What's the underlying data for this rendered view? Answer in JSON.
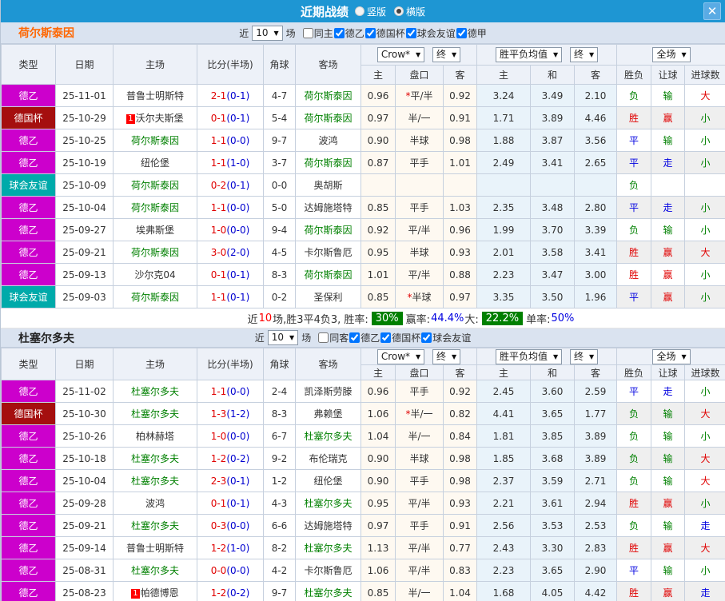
{
  "titlebar": {
    "title": "近期战绩",
    "options": [
      {
        "label": "竖版",
        "selected": false
      },
      {
        "label": "横版",
        "selected": true
      }
    ],
    "close_glyph": "✕"
  },
  "labels": {
    "near": "近",
    "matches": "场"
  },
  "columns": {
    "type": "类型",
    "date": "日期",
    "home": "主场",
    "score": "比分(半场)",
    "corner": "角球",
    "away": "客场",
    "odds_home": "主",
    "handicap": "盘口",
    "odds_away": "客",
    "mean_home": "主",
    "mean_draw": "和",
    "mean_away": "客",
    "result": "胜负",
    "handicap_result": "让球",
    "goals": "进球数"
  },
  "dropdowns": {
    "crow": "Crow*",
    "final1": "终",
    "mean": "胜平负均值",
    "final2": "终",
    "fullmatch": "全场"
  },
  "type_colors": {
    "德乙": "#cc00cc",
    "德国杯": "#a50f0f",
    "球会友谊": "#00aaaa"
  },
  "result_colors": {
    "胜": "#e00000",
    "赢": "#e00000",
    "大": "#e00000",
    "平": "#0000e0",
    "走": "#0000e0",
    "负": "#008000",
    "输": "#008000",
    "小": "#008000"
  },
  "team_green": "#008000",
  "sections": [
    {
      "team": "荷尔斯泰因",
      "team_color": "#ff6600",
      "filter": {
        "count": "10",
        "items": [
          {
            "label": "同主",
            "checked": false
          },
          {
            "label": "德乙",
            "checked": true
          },
          {
            "label": "德国杯",
            "checked": true
          },
          {
            "label": "球会友谊",
            "checked": true
          },
          {
            "label": "德甲",
            "checked": true
          }
        ]
      },
      "rows": [
        {
          "type": "德乙",
          "date": "25-11-01",
          "home": "普鲁士明斯特",
          "badge": "",
          "score": "2-1",
          "half": "(0-1)",
          "corner": "4-7",
          "away": "荷尔斯泰因",
          "odds_home": "0.96",
          "star": true,
          "handicap": "平/半",
          "odds_away": "0.92",
          "mean_home": "3.24",
          "mean_draw": "3.49",
          "mean_away": "2.10",
          "result": "负",
          "let": "输",
          "goals": "大"
        },
        {
          "type": "德国杯",
          "date": "25-10-29",
          "home": "沃尔夫斯堡",
          "badge": "1",
          "score": "0-1",
          "half": "(0-1)",
          "corner": "5-4",
          "away": "荷尔斯泰因",
          "odds_home": "0.97",
          "star": false,
          "handicap": "半/一",
          "odds_away": "0.91",
          "mean_home": "1.71",
          "mean_draw": "3.89",
          "mean_away": "4.46",
          "result": "胜",
          "let": "赢",
          "goals": "小"
        },
        {
          "type": "德乙",
          "date": "25-10-25",
          "home": "荷尔斯泰因",
          "badge": "",
          "score": "1-1",
          "half": "(0-0)",
          "corner": "9-7",
          "away": "波鸿",
          "odds_home": "0.90",
          "star": false,
          "handicap": "半球",
          "odds_away": "0.98",
          "mean_home": "1.88",
          "mean_draw": "3.87",
          "mean_away": "3.56",
          "result": "平",
          "let": "输",
          "goals": "小"
        },
        {
          "type": "德乙",
          "date": "25-10-19",
          "home": "纽伦堡",
          "badge": "",
          "score": "1-1",
          "half": "(1-0)",
          "corner": "3-7",
          "away": "荷尔斯泰因",
          "odds_home": "0.87",
          "star": false,
          "handicap": "平手",
          "odds_away": "1.01",
          "mean_home": "2.49",
          "mean_draw": "3.41",
          "mean_away": "2.65",
          "result": "平",
          "let": "走",
          "goals": "小"
        },
        {
          "type": "球会友谊",
          "date": "25-10-09",
          "home": "荷尔斯泰因",
          "badge": "",
          "score": "0-2",
          "half": "(0-1)",
          "corner": "0-0",
          "away": "奥胡斯",
          "odds_home": "",
          "star": false,
          "handicap": "",
          "odds_away": "",
          "mean_home": "",
          "mean_draw": "",
          "mean_away": "",
          "result": "负",
          "let": "",
          "goals": ""
        },
        {
          "type": "德乙",
          "date": "25-10-04",
          "home": "荷尔斯泰因",
          "badge": "",
          "score": "1-1",
          "half": "(0-0)",
          "corner": "5-0",
          "away": "达姆施塔特",
          "odds_home": "0.85",
          "star": false,
          "handicap": "平手",
          "odds_away": "1.03",
          "mean_home": "2.35",
          "mean_draw": "3.48",
          "mean_away": "2.80",
          "result": "平",
          "let": "走",
          "goals": "小"
        },
        {
          "type": "德乙",
          "date": "25-09-27",
          "home": "埃弗斯堡",
          "badge": "",
          "score": "1-0",
          "half": "(0-0)",
          "corner": "9-4",
          "away": "荷尔斯泰因",
          "odds_home": "0.92",
          "star": false,
          "handicap": "平/半",
          "odds_away": "0.96",
          "mean_home": "1.99",
          "mean_draw": "3.70",
          "mean_away": "3.39",
          "result": "负",
          "let": "输",
          "goals": "小"
        },
        {
          "type": "德乙",
          "date": "25-09-21",
          "home": "荷尔斯泰因",
          "badge": "",
          "score": "3-0",
          "half": "(2-0)",
          "corner": "4-5",
          "away": "卡尔斯鲁厄",
          "odds_home": "0.95",
          "star": false,
          "handicap": "半球",
          "odds_away": "0.93",
          "mean_home": "2.01",
          "mean_draw": "3.58",
          "mean_away": "3.41",
          "result": "胜",
          "let": "赢",
          "goals": "大"
        },
        {
          "type": "德乙",
          "date": "25-09-13",
          "home": "沙尔克04",
          "badge": "",
          "score": "0-1",
          "half": "(0-1)",
          "corner": "8-3",
          "away": "荷尔斯泰因",
          "odds_home": "1.01",
          "star": false,
          "handicap": "平/半",
          "odds_away": "0.88",
          "mean_home": "2.23",
          "mean_draw": "3.47",
          "mean_away": "3.00",
          "result": "胜",
          "let": "赢",
          "goals": "小"
        },
        {
          "type": "球会友谊",
          "date": "25-09-03",
          "home": "荷尔斯泰因",
          "badge": "",
          "score": "1-1",
          "half": "(0-1)",
          "corner": "0-2",
          "away": "圣保利",
          "odds_home": "0.85",
          "star": true,
          "handicap": "半球",
          "odds_away": "0.97",
          "mean_home": "3.35",
          "mean_draw": "3.50",
          "mean_away": "1.96",
          "result": "平",
          "let": "赢",
          "goals": "小"
        }
      ],
      "summary": [
        {
          "t": "近",
          "c": "k"
        },
        {
          "t": "10",
          "c": "r"
        },
        {
          "t": "场,胜3平4负3, 胜率:",
          "c": "k"
        },
        {
          "t": "30%",
          "c": "g"
        },
        {
          "t": "赢率:",
          "c": "k"
        },
        {
          "t": "44.4%",
          "c": "b"
        },
        {
          "t": " 大:",
          "c": "k"
        },
        {
          "t": "22.2%",
          "c": "g"
        },
        {
          "t": "单率:",
          "c": "k"
        },
        {
          "t": "50%",
          "c": "b"
        }
      ]
    },
    {
      "team": "杜塞尔多夫",
      "team_color": "#222222",
      "filter": {
        "count": "10",
        "items": [
          {
            "label": "同客",
            "checked": false
          },
          {
            "label": "德乙",
            "checked": true
          },
          {
            "label": "德国杯",
            "checked": true
          },
          {
            "label": "球会友谊",
            "checked": true
          }
        ]
      },
      "rows": [
        {
          "type": "德乙",
          "date": "25-11-02",
          "home": "杜塞尔多夫",
          "badge": "",
          "score": "1-1",
          "half": "(0-0)",
          "corner": "2-4",
          "away": "凯泽斯劳滕",
          "odds_home": "0.96",
          "star": false,
          "handicap": "平手",
          "odds_away": "0.92",
          "mean_home": "2.45",
          "mean_draw": "3.60",
          "mean_away": "2.59",
          "result": "平",
          "let": "走",
          "goals": "小"
        },
        {
          "type": "德国杯",
          "date": "25-10-30",
          "home": "杜塞尔多夫",
          "badge": "",
          "score": "1-3",
          "half": "(1-2)",
          "corner": "8-3",
          "away": "弗赖堡",
          "odds_home": "1.06",
          "star": true,
          "handicap": "半/一",
          "odds_away": "0.82",
          "mean_home": "4.41",
          "mean_draw": "3.65",
          "mean_away": "1.77",
          "result": "负",
          "let": "输",
          "goals": "大"
        },
        {
          "type": "德乙",
          "date": "25-10-26",
          "home": "柏林赫塔",
          "badge": "",
          "score": "1-0",
          "half": "(0-0)",
          "corner": "6-7",
          "away": "杜塞尔多夫",
          "odds_home": "1.04",
          "star": false,
          "handicap": "半/一",
          "odds_away": "0.84",
          "mean_home": "1.81",
          "mean_draw": "3.85",
          "mean_away": "3.89",
          "result": "负",
          "let": "输",
          "goals": "小"
        },
        {
          "type": "德乙",
          "date": "25-10-18",
          "home": "杜塞尔多夫",
          "badge": "",
          "score": "1-2",
          "half": "(0-2)",
          "corner": "9-2",
          "away": "布伦瑞克",
          "odds_home": "0.90",
          "star": false,
          "handicap": "半球",
          "odds_away": "0.98",
          "mean_home": "1.85",
          "mean_draw": "3.68",
          "mean_away": "3.89",
          "result": "负",
          "let": "输",
          "goals": "大"
        },
        {
          "type": "德乙",
          "date": "25-10-04",
          "home": "杜塞尔多夫",
          "badge": "",
          "score": "2-3",
          "half": "(0-1)",
          "corner": "1-2",
          "away": "纽伦堡",
          "odds_home": "0.90",
          "star": false,
          "handicap": "平手",
          "odds_away": "0.98",
          "mean_home": "2.37",
          "mean_draw": "3.59",
          "mean_away": "2.71",
          "result": "负",
          "let": "输",
          "goals": "大"
        },
        {
          "type": "德乙",
          "date": "25-09-28",
          "home": "波鸿",
          "badge": "",
          "score": "0-1",
          "half": "(0-1)",
          "corner": "4-3",
          "away": "杜塞尔多夫",
          "odds_home": "0.95",
          "star": false,
          "handicap": "平/半",
          "odds_away": "0.93",
          "mean_home": "2.21",
          "mean_draw": "3.61",
          "mean_away": "2.94",
          "result": "胜",
          "let": "赢",
          "goals": "小"
        },
        {
          "type": "德乙",
          "date": "25-09-21",
          "home": "杜塞尔多夫",
          "badge": "",
          "score": "0-3",
          "half": "(0-0)",
          "corner": "6-6",
          "away": "达姆施塔特",
          "odds_home": "0.97",
          "star": false,
          "handicap": "平手",
          "odds_away": "0.91",
          "mean_home": "2.56",
          "mean_draw": "3.53",
          "mean_away": "2.53",
          "result": "负",
          "let": "输",
          "goals": "走"
        },
        {
          "type": "德乙",
          "date": "25-09-14",
          "home": "普鲁士明斯特",
          "badge": "",
          "score": "1-2",
          "half": "(1-0)",
          "corner": "8-2",
          "away": "杜塞尔多夫",
          "odds_home": "1.13",
          "star": false,
          "handicap": "平/半",
          "odds_away": "0.77",
          "mean_home": "2.43",
          "mean_draw": "3.30",
          "mean_away": "2.83",
          "result": "胜",
          "let": "赢",
          "goals": "大"
        },
        {
          "type": "德乙",
          "date": "25-08-31",
          "home": "杜塞尔多夫",
          "badge": "",
          "score": "0-0",
          "half": "(0-0)",
          "corner": "4-2",
          "away": "卡尔斯鲁厄",
          "odds_home": "1.06",
          "star": false,
          "handicap": "平/半",
          "odds_away": "0.83",
          "mean_home": "2.23",
          "mean_draw": "3.65",
          "mean_away": "2.90",
          "result": "平",
          "let": "输",
          "goals": "小"
        },
        {
          "type": "德乙",
          "date": "25-08-23",
          "home": "帕德博恩",
          "badge": "1",
          "score": "1-2",
          "half": "(0-2)",
          "corner": "9-7",
          "away": "杜塞尔多夫",
          "odds_home": "0.85",
          "star": false,
          "handicap": "半/一",
          "odds_away": "1.04",
          "mean_home": "1.68",
          "mean_draw": "4.05",
          "mean_away": "4.42",
          "result": "胜",
          "let": "赢",
          "goals": "走"
        }
      ],
      "summary": null
    }
  ]
}
